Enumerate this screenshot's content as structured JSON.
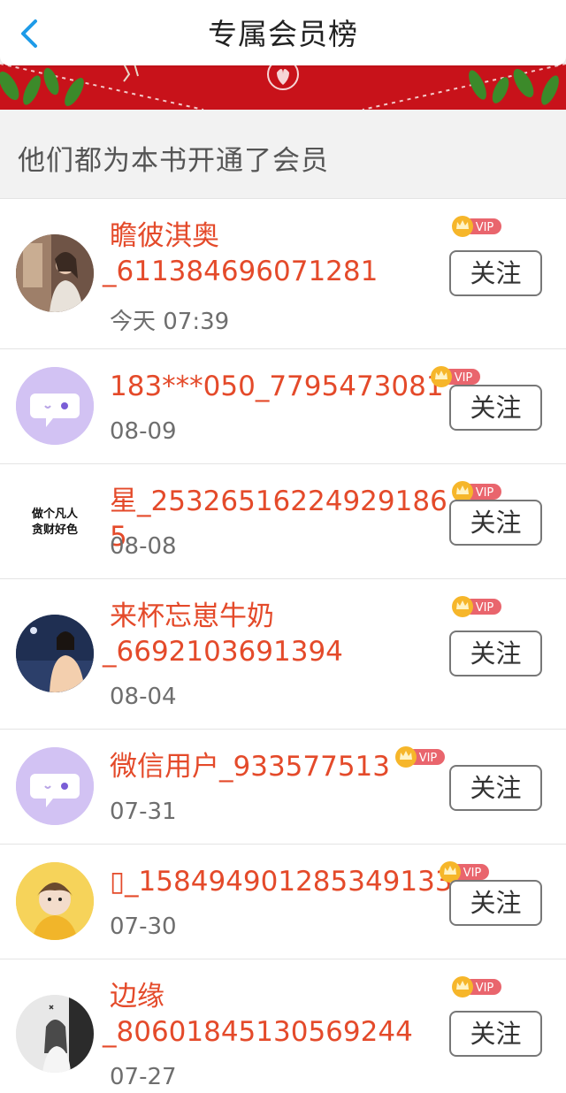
{
  "header": {
    "title": "专属会员榜"
  },
  "subheading": "他们都为本书开通了会员",
  "vip_label": "VIP",
  "follow_label": "关注",
  "avatar_texts": [
    "做个凡人",
    "贪财好色"
  ],
  "members": [
    {
      "name_line1": "瞻彼淇奥",
      "name_line2": "_611384696071281",
      "date": "今天 07:39"
    },
    {
      "name_line1": "183***050_7795473081",
      "name_line2": "",
      "date": "08-09"
    },
    {
      "name_line1": "星_253265162249291865",
      "name_line2": "",
      "date": "08-08"
    },
    {
      "name_line1": "来杯忘崽牛奶",
      "name_line2": "_6692103691394",
      "date": "08-04"
    },
    {
      "name_line1": "微信用户_933577513",
      "name_line2": "",
      "date": "07-31"
    },
    {
      "name_line1": "▯_158494901285349133",
      "name_line2": "",
      "date": "07-30"
    },
    {
      "name_line1": "边缘",
      "name_line2": "_80601845130569244",
      "date": "07-27"
    }
  ],
  "colors": {
    "name": "#e44a2a",
    "banner": "#c8121a",
    "back_arrow": "#1e9be8",
    "vip_badge": "#e9656d"
  }
}
